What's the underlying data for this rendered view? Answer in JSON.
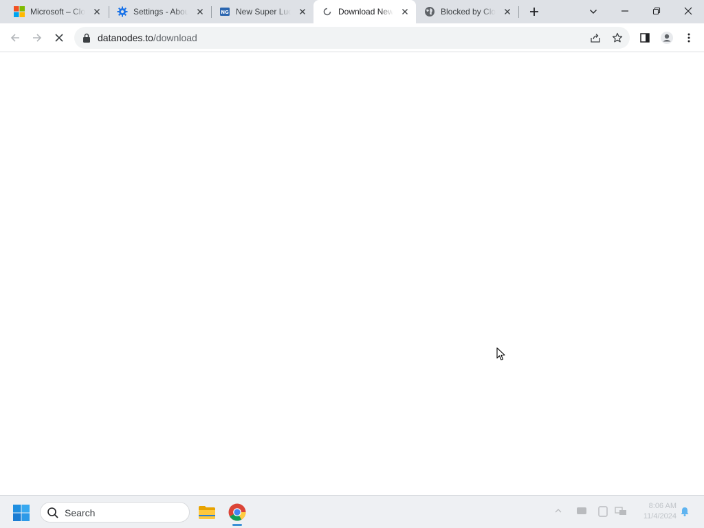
{
  "browser": {
    "tabs": [
      {
        "title": "Microsoft – Clo",
        "favicon": "microsoft-logo-icon",
        "active": false
      },
      {
        "title": "Settings - Abou",
        "favicon": "gear-icon",
        "active": false
      },
      {
        "title": "New Super Luc",
        "favicon": "ng-site-icon",
        "active": false
      },
      {
        "title": "Download New",
        "favicon": "loading-spinner-icon",
        "active": true
      },
      {
        "title": "Blocked by Clo",
        "favicon": "globe-icon",
        "active": false
      }
    ],
    "url": {
      "host": "datanodes.to",
      "path": "/download"
    },
    "accent": "#1a73e8"
  },
  "taskbar": {
    "search_placeholder": "Search",
    "clock": {
      "time": "8:06 AM",
      "date": "11/4/2024"
    }
  }
}
